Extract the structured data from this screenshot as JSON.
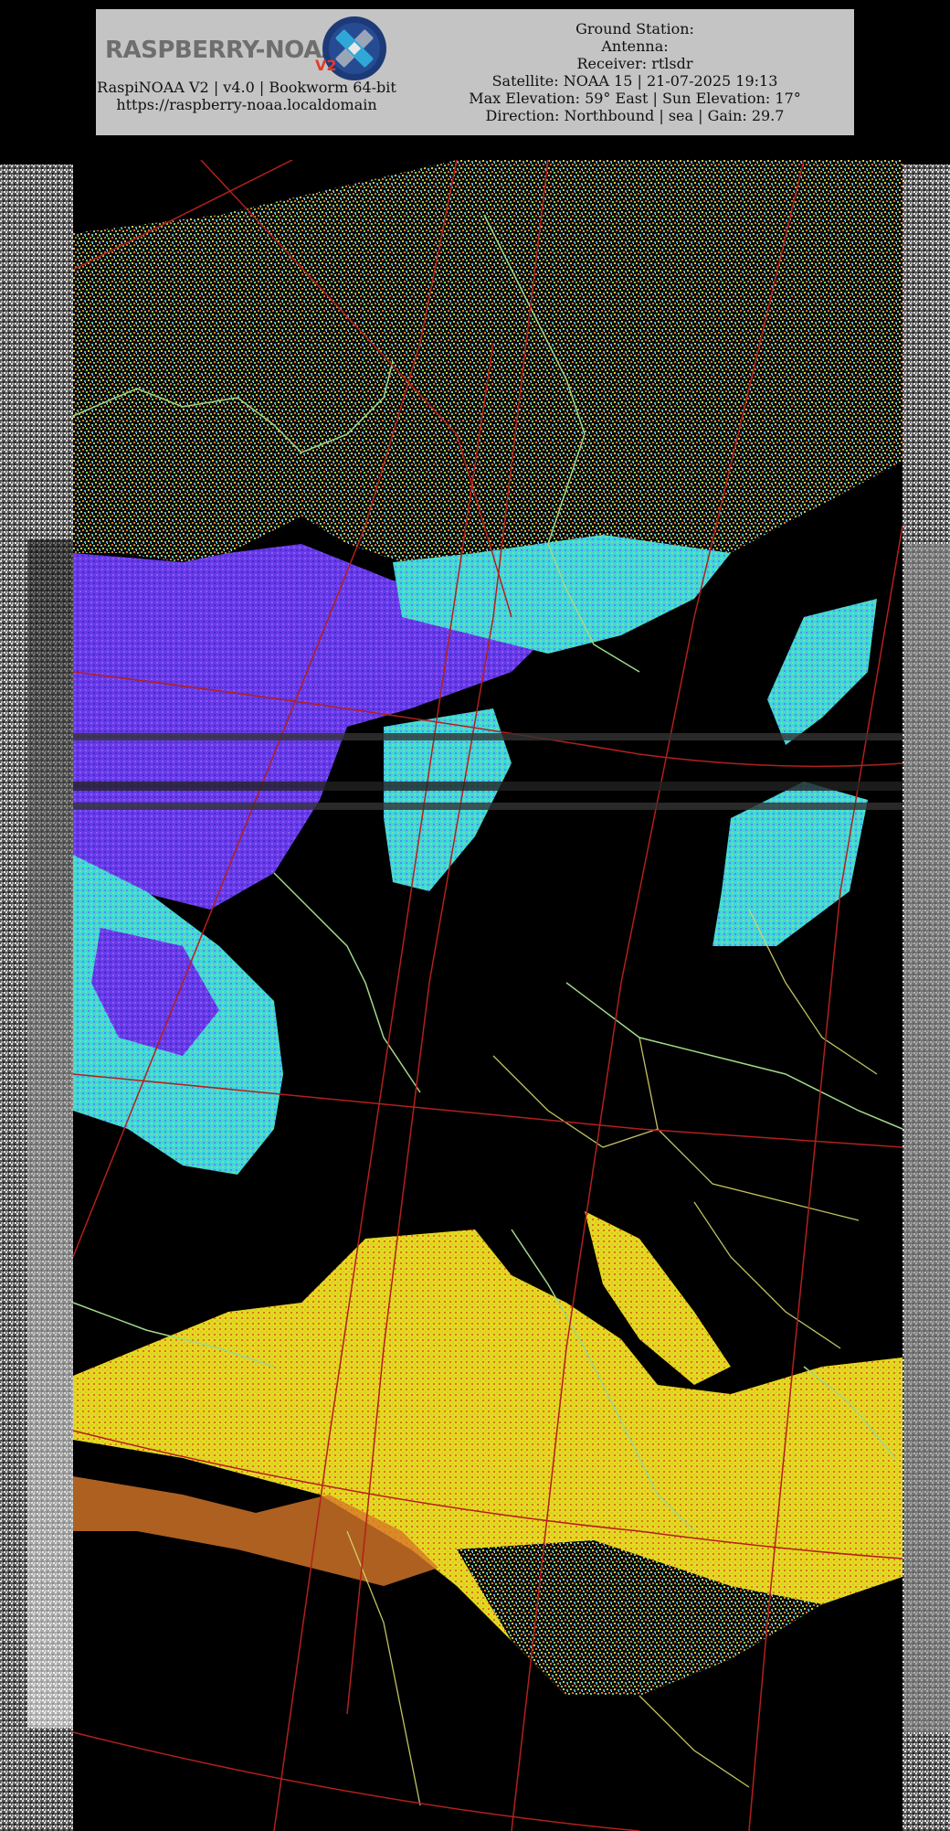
{
  "header": {
    "logo_text": "RASPBERRY-NOAA",
    "logo_badge": "V2",
    "app_line": "RaspiNOAA V2 | v4.0 | Bookworm 64-bit",
    "url": "https://raspberry-noaa.localdomain"
  },
  "station_info": {
    "ground_station": "Ground Station:",
    "antenna": "Antenna:",
    "receiver": "Receiver: rtlsdr",
    "satellite": "Satellite: NOAA 15 | 21-07-2025 19:13",
    "elevation": "Max Elevation: 59° East | Sun Elevation: 17°",
    "direction": "Direction: Northbound | sea | Gain: 29.7"
  },
  "imagery": {
    "description_icon": "satellite-weather-map",
    "colors": {
      "border_lines": "#a0d88a",
      "graticule": "#b2201c",
      "cloud_purple": "#7a3cf0",
      "cloud_blue": "#3b2fd8",
      "cloud_cyan": "#3fe0e0",
      "warm_yellow": "#e8e020",
      "warm_orange": "#e07020",
      "green": "#7ad060"
    }
  }
}
